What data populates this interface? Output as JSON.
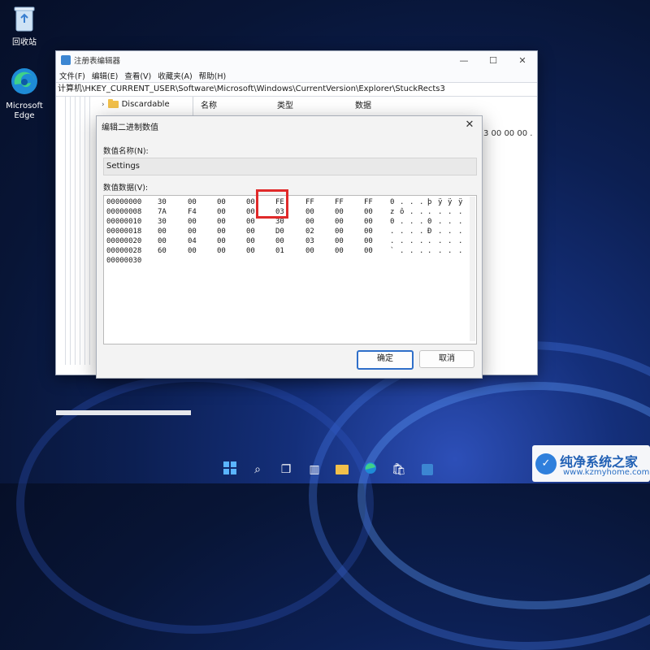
{
  "desktop": {
    "recycle_bin_label": "回收站",
    "edge_label_1": "Microsoft",
    "edge_label_2": "Edge"
  },
  "regedit": {
    "title": "注册表编辑器",
    "menu": [
      "文件(F)",
      "编辑(E)",
      "查看(V)",
      "收藏夹(A)",
      "帮助(H)"
    ],
    "address": "计算机\\HKEY_CURRENT_USER\\Software\\Microsoft\\Windows\\CurrentVersion\\Explorer\\StuckRects3",
    "tree_item": "Discardable",
    "columns": {
      "name": "名称",
      "type": "类型",
      "data": "数据"
    },
    "value_tail": "3 00 00 00 ."
  },
  "dialog": {
    "title": "编辑二进制数值",
    "name_label": "数值名称(N):",
    "name_value": "Settings",
    "data_label": "数值数据(V):",
    "rows": [
      {
        "offset": "00000000",
        "bytes": [
          "30",
          "00",
          "00",
          "00",
          "FE",
          "FF",
          "FF",
          "FF"
        ],
        "ascii": [
          "0",
          ".",
          ".",
          ".",
          "þ",
          "ÿ",
          "ÿ",
          "ÿ"
        ]
      },
      {
        "offset": "00000008",
        "bytes": [
          "7A",
          "F4",
          "00",
          "00",
          "03",
          "00",
          "00",
          "00"
        ],
        "ascii": [
          "z",
          "ô",
          ".",
          ".",
          ".",
          ".",
          ".",
          "."
        ]
      },
      {
        "offset": "00000010",
        "bytes": [
          "30",
          "00",
          "00",
          "00",
          "30",
          "00",
          "00",
          "00"
        ],
        "ascii": [
          "0",
          ".",
          ".",
          ".",
          "0",
          ".",
          ".",
          "."
        ]
      },
      {
        "offset": "00000018",
        "bytes": [
          "00",
          "00",
          "00",
          "00",
          "D0",
          "02",
          "00",
          "00"
        ],
        "ascii": [
          ".",
          ".",
          ".",
          ".",
          "Ð",
          ".",
          ".",
          "."
        ]
      },
      {
        "offset": "00000020",
        "bytes": [
          "00",
          "04",
          "00",
          "00",
          "00",
          "03",
          "00",
          "00"
        ],
        "ascii": [
          ".",
          ".",
          ".",
          ".",
          ".",
          ".",
          ".",
          "."
        ]
      },
      {
        "offset": "00000028",
        "bytes": [
          "60",
          "00",
          "00",
          "00",
          "01",
          "00",
          "00",
          "00"
        ],
        "ascii": [
          "`",
          ".",
          ".",
          ".",
          ".",
          ".",
          ".",
          "."
        ]
      },
      {
        "offset": "00000030",
        "bytes": [],
        "ascii": []
      }
    ],
    "ok_label": "确定",
    "cancel_label": "取消"
  },
  "watermark": {
    "title": "纯净系统之家",
    "url": "www.kzmyhome.com"
  }
}
